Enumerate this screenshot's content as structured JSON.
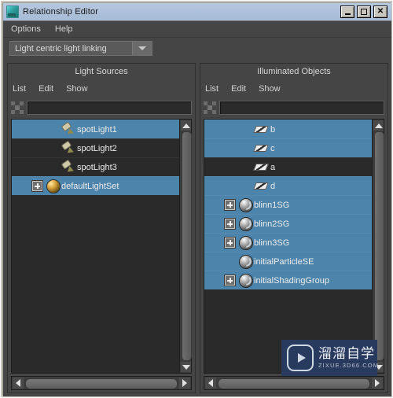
{
  "window": {
    "title": "Relationship Editor",
    "icon": "app-icon",
    "buttons": [
      {
        "name": "minimize",
        "glyph": "minimize-icon"
      },
      {
        "name": "maximize",
        "glyph": "maximize-icon"
      },
      {
        "name": "close",
        "glyph": "close-icon"
      }
    ]
  },
  "menubar": {
    "items": [
      {
        "label": "Options"
      },
      {
        "label": "Help"
      }
    ]
  },
  "mode_selector": {
    "value": "Light centric light linking",
    "arrow_icon": "chevron-down-icon"
  },
  "left_pane": {
    "title": "Light Sources",
    "menu": [
      {
        "label": "List"
      },
      {
        "label": "Edit"
      },
      {
        "label": "Show"
      }
    ],
    "filter": {
      "value": "",
      "placeholder": "",
      "icon": "filter-move-icon"
    },
    "items": [
      {
        "label": "spotLight1",
        "icon": "spot-light-icon",
        "selected": true,
        "expandable": false,
        "indent": 64
      },
      {
        "label": "spotLight2",
        "icon": "spot-light-icon",
        "selected": false,
        "expandable": false,
        "indent": 64
      },
      {
        "label": "spotLight3",
        "icon": "spot-light-icon",
        "selected": false,
        "expandable": false,
        "indent": 64
      },
      {
        "label": "defaultLightSet",
        "icon": "light-set-icon",
        "selected": true,
        "expandable": true,
        "indent": 22
      }
    ],
    "vscroll": {
      "up_icon": "scroll-up-icon",
      "down_icon": "scroll-down-icon"
    },
    "hscroll": {
      "left_icon": "scroll-left-icon",
      "right_icon": "scroll-right-icon"
    }
  },
  "right_pane": {
    "title": "Illuminated Objects",
    "menu": [
      {
        "label": "List"
      },
      {
        "label": "Edit"
      },
      {
        "label": "Show"
      }
    ],
    "filter": {
      "value": "",
      "placeholder": "",
      "icon": "filter-move-icon"
    },
    "items": [
      {
        "label": "b",
        "icon": "mesh-icon",
        "selected": true,
        "expandable": false,
        "indent": 64
      },
      {
        "label": "c",
        "icon": "mesh-icon",
        "selected": true,
        "expandable": false,
        "indent": 64
      },
      {
        "label": "a",
        "icon": "mesh-icon",
        "selected": false,
        "expandable": false,
        "indent": 64
      },
      {
        "label": "d",
        "icon": "mesh-icon",
        "selected": true,
        "expandable": false,
        "indent": 64
      },
      {
        "label": "blinn1SG",
        "icon": "shader-icon",
        "selected": true,
        "expandable": true,
        "indent": 22
      },
      {
        "label": "blinn2SG",
        "icon": "shader-icon",
        "selected": true,
        "expandable": true,
        "indent": 22
      },
      {
        "label": "blinn3SG",
        "icon": "shader-icon",
        "selected": true,
        "expandable": true,
        "indent": 22
      },
      {
        "label": "initialParticleSE",
        "icon": "shader-icon",
        "selected": true,
        "expandable": false,
        "indent": 22
      },
      {
        "label": "initialShadingGroup",
        "icon": "shader-icon",
        "selected": true,
        "expandable": true,
        "indent": 22
      }
    ],
    "vscroll": {
      "up_icon": "scroll-up-icon",
      "down_icon": "scroll-down-icon"
    },
    "hscroll": {
      "left_icon": "scroll-left-icon",
      "right_icon": "scroll-right-icon"
    }
  },
  "watermark": {
    "cn_text": "溜溜自学",
    "en_text": "ZIXUE.3D66.COM",
    "logo_icon": "play-button-icon"
  },
  "colors": {
    "selection_blue": "#4d84ab",
    "panel_bg": "#454545",
    "list_bg": "#2a2a2a",
    "titlebar_blue": "#aec1da",
    "watermark_bg": "#283a5e"
  }
}
